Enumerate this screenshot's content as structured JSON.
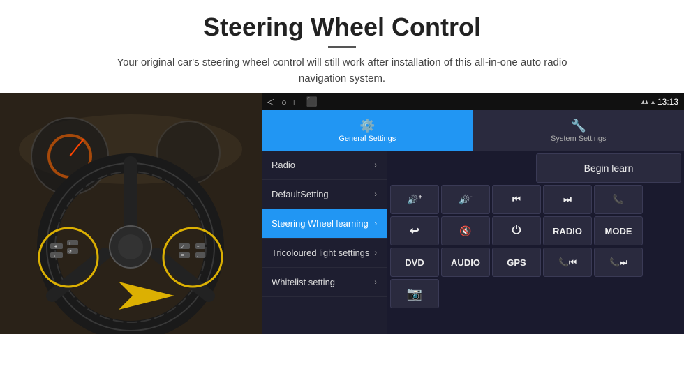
{
  "page": {
    "title": "Steering Wheel Control",
    "divider": "—",
    "subtitle": "Your original car's steering wheel control will still work after installation of this all-in-one auto radio navigation system."
  },
  "status_bar": {
    "back_icon": "◁",
    "home_icon": "○",
    "recent_icon": "□",
    "screenshot_icon": "⬛",
    "signal_icon": "▲",
    "wifi_icon": "▲",
    "time": "13:13"
  },
  "tabs": [
    {
      "id": "general",
      "label": "General Settings",
      "icon": "⚙",
      "active": true
    },
    {
      "id": "system",
      "label": "System Settings",
      "icon": "⚙",
      "active": false
    }
  ],
  "menu": {
    "items": [
      {
        "label": "Radio",
        "active": false
      },
      {
        "label": "DefaultSetting",
        "active": false
      },
      {
        "label": "Steering Wheel learning",
        "active": true
      },
      {
        "label": "Tricoloured light settings",
        "active": false
      },
      {
        "label": "Whitelist setting",
        "active": false
      }
    ]
  },
  "controls": {
    "begin_learn_label": "Begin learn",
    "row1": [
      {
        "icon": "🔊+",
        "label": "vol-up"
      },
      {
        "icon": "🔊-",
        "label": "vol-down"
      },
      {
        "icon": "⏮",
        "label": "prev"
      },
      {
        "icon": "⏭",
        "label": "next"
      },
      {
        "icon": "📞",
        "label": "call"
      }
    ],
    "row2": [
      {
        "icon": "↩",
        "label": "back"
      },
      {
        "icon": "🔇",
        "label": "mute"
      },
      {
        "icon": "⏻",
        "label": "power"
      },
      {
        "text": "RADIO",
        "label": "radio-btn"
      },
      {
        "text": "MODE",
        "label": "mode-btn"
      }
    ],
    "row3": [
      {
        "text": "DVD",
        "label": "dvd-btn"
      },
      {
        "text": "AUDIO",
        "label": "audio-btn"
      },
      {
        "text": "GPS",
        "label": "gps-btn"
      },
      {
        "icon": "📞⏮",
        "label": "call-prev"
      },
      {
        "icon": "📞⏭",
        "label": "call-next"
      }
    ],
    "row4": [
      {
        "icon": "📷",
        "label": "camera"
      }
    ]
  }
}
